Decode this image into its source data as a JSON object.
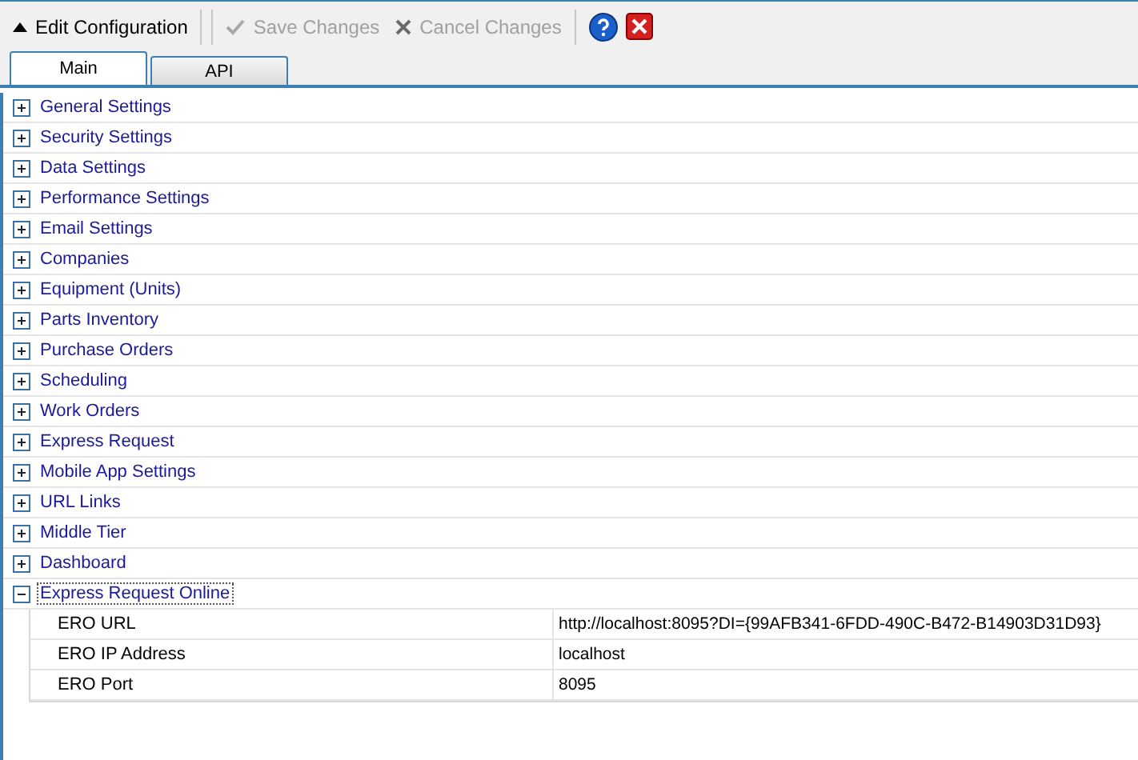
{
  "toolbar": {
    "items": [
      {
        "kind": "menu",
        "label": "Edit Configuration",
        "disabled": false
      },
      {
        "kind": "save",
        "label": "Save Changes",
        "disabled": true
      },
      {
        "kind": "cancel",
        "label": "Cancel Changes",
        "disabled": true
      },
      {
        "kind": "help"
      },
      {
        "kind": "close"
      }
    ]
  },
  "tabs": [
    {
      "label": "Main",
      "selected": true
    },
    {
      "label": "API",
      "selected": false
    }
  ],
  "categories": [
    {
      "label": "General Settings",
      "expanded": false,
      "selected": false
    },
    {
      "label": "Security Settings",
      "expanded": false,
      "selected": false
    },
    {
      "label": "Data Settings",
      "expanded": false,
      "selected": false
    },
    {
      "label": "Performance Settings",
      "expanded": false,
      "selected": false
    },
    {
      "label": "Email Settings",
      "expanded": false,
      "selected": false
    },
    {
      "label": "Companies",
      "expanded": false,
      "selected": false
    },
    {
      "label": "Equipment (Units)",
      "expanded": false,
      "selected": false
    },
    {
      "label": "Parts Inventory",
      "expanded": false,
      "selected": false
    },
    {
      "label": "Purchase Orders",
      "expanded": false,
      "selected": false
    },
    {
      "label": "Scheduling",
      "expanded": false,
      "selected": false
    },
    {
      "label": "Work Orders",
      "expanded": false,
      "selected": false
    },
    {
      "label": "Express Request",
      "expanded": false,
      "selected": false
    },
    {
      "label": "Mobile App Settings",
      "expanded": false,
      "selected": false
    },
    {
      "label": "URL Links",
      "expanded": false,
      "selected": false
    },
    {
      "label": "Middle Tier",
      "expanded": false,
      "selected": false
    },
    {
      "label": "Dashboard",
      "expanded": false,
      "selected": false
    },
    {
      "label": "Express Request Online",
      "expanded": true,
      "selected": true,
      "children": [
        {
          "name": "ERO URL",
          "value": "http://localhost:8095?DI={99AFB341-6FDD-490C-B472-B14903D31D93}"
        },
        {
          "name": "ERO IP Address",
          "value": "localhost"
        },
        {
          "name": "ERO Port",
          "value": "8095"
        }
      ]
    }
  ]
}
